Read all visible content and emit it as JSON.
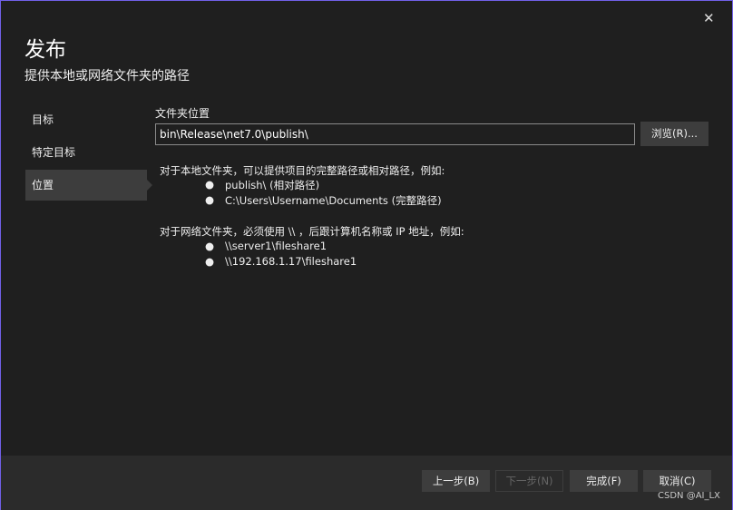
{
  "dialog": {
    "title": "发布",
    "subtitle": "提供本地或网络文件夹的路径",
    "close_icon": "close-icon"
  },
  "nav": {
    "items": [
      {
        "label": "目标"
      },
      {
        "label": "特定目标"
      },
      {
        "label": "位置",
        "active": true
      }
    ]
  },
  "form": {
    "folder_label": "文件夹位置",
    "folder_value": "bin\\Release\\net7.0\\publish\\",
    "browse_label": "浏览(R)..."
  },
  "help": {
    "local_intro": "对于本地文件夹，可以提供项目的完整路径或相对路径，例如:",
    "local_examples": [
      "publish\\ (相对路径)",
      "C:\\Users\\Username\\Documents (完整路径)"
    ],
    "network_intro": "对于网络文件夹，必须使用 \\\\ ，后跟计算机名称或 IP 地址，例如:",
    "network_examples": [
      "\\\\server1\\fileshare1",
      "\\\\192.168.1.17\\fileshare1"
    ],
    "bullet": "●"
  },
  "footer": {
    "back": "上一步(B)",
    "next": "下一步(N)",
    "finish": "完成(F)",
    "cancel": "取消(C)"
  },
  "watermark": "CSDN @AI_LX",
  "colors": {
    "accent_border": "#7160e8",
    "background": "#1f1f1f",
    "button": "#3d3d3d"
  }
}
